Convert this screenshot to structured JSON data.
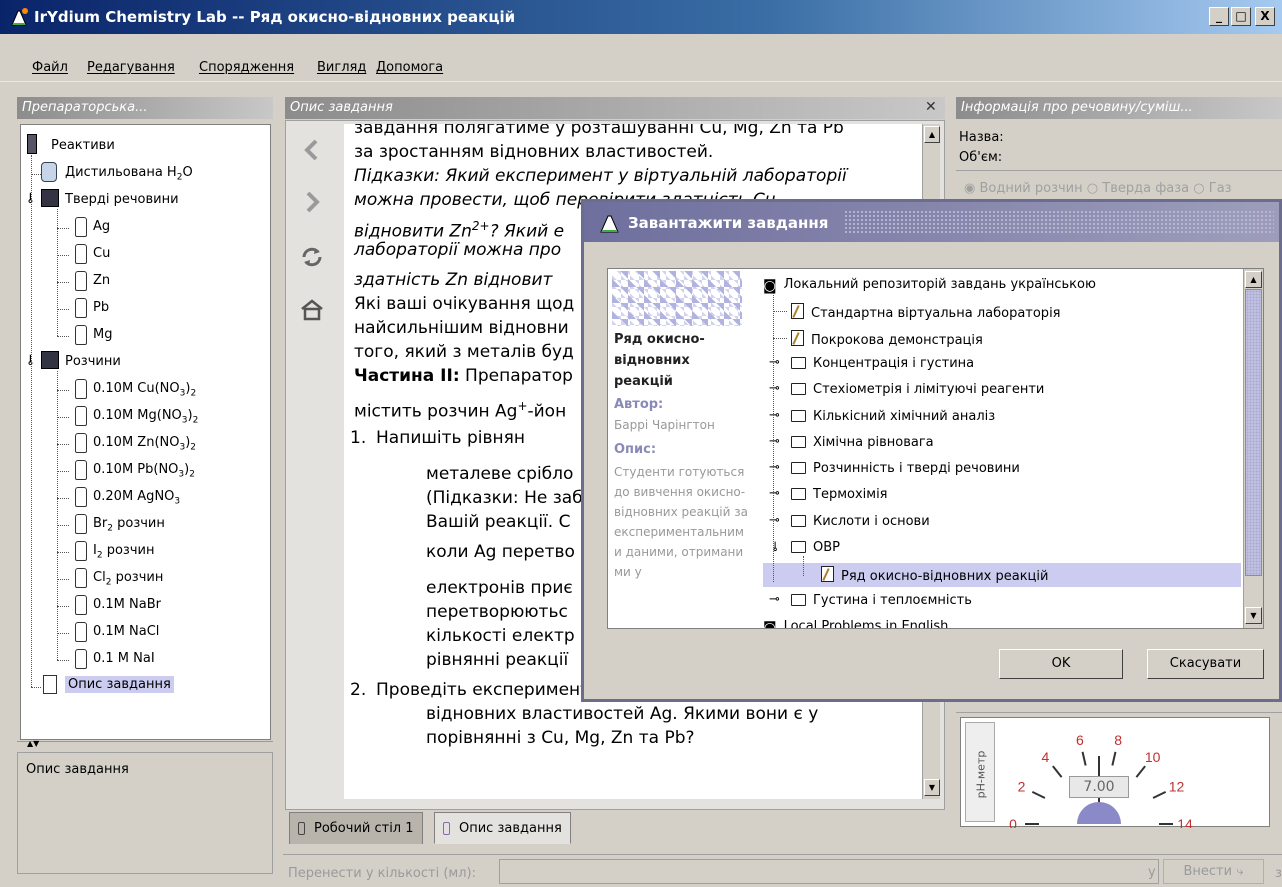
{
  "window": {
    "title": "IrYdium Chemistry Lab -- Ряд окисно-відновних реакцій",
    "controls": [
      "_",
      "□",
      "X"
    ]
  },
  "menu": [
    "Файл",
    "Редагування",
    "Спорядження",
    "Вигляд",
    "Допомога"
  ],
  "stockroom": {
    "header": "Препараторська...",
    "tree": [
      {
        "label": "Реактиви",
        "icon": "bottle-dark-icon"
      },
      {
        "label": "Дистильована H",
        "sub": "2",
        "suffix": "O",
        "icon": "water-jug-icon"
      },
      {
        "label": "Тверді речовини",
        "icon": "folder-icon"
      },
      {
        "label": "Ag",
        "icon": "bottle-icon"
      },
      {
        "label": "Cu",
        "icon": "bottle-icon"
      },
      {
        "label": "Zn",
        "icon": "bottle-icon"
      },
      {
        "label": "Pb",
        "icon": "bottle-icon"
      },
      {
        "label": "Mg",
        "icon": "bottle-icon"
      },
      {
        "label": "Розчини",
        "icon": "folder-icon"
      },
      {
        "label": "0.10M Cu(NO",
        "sub": "3",
        "suffix": ")",
        "sub2": "2",
        "icon": "bottle-icon"
      },
      {
        "label": "0.10M Mg(NO",
        "sub": "3",
        "suffix": ")",
        "sub2": "2",
        "icon": "bottle-icon"
      },
      {
        "label": "0.10M Zn(NO",
        "sub": "3",
        "suffix": ")",
        "sub2": "2",
        "icon": "bottle-icon"
      },
      {
        "label": "0.10M Pb(NO",
        "sub": "3",
        "suffix": ")",
        "sub2": "2",
        "icon": "bottle-icon"
      },
      {
        "label": "0.20M AgNO",
        "sub": "3",
        "icon": "bottle-icon"
      },
      {
        "label": "Br",
        "sub": "2",
        "suffix": " розчин",
        "icon": "bottle-icon"
      },
      {
        "label": "I",
        "sub": "2",
        "suffix": " розчин",
        "icon": "bottle-icon"
      },
      {
        "label": "Cl",
        "sub": "2",
        "suffix": " розчин",
        "icon": "bottle-icon"
      },
      {
        "label": "0.1M NaBr",
        "icon": "bottle-icon"
      },
      {
        "label": "0.1M NaCl",
        "icon": "bottle-icon"
      },
      {
        "label": "0.1 M NaI",
        "icon": "bottle-icon"
      },
      {
        "label": "Опис завдання",
        "icon": "document-icon",
        "selected": true
      }
    ],
    "bottom_label": "Опис завдання"
  },
  "task_panel": {
    "header": "Опис завдання",
    "lines": [
      {
        "text": "завдання полягатиме у розташуванні Cu, Mg, Zn та Pb",
        "style": "n"
      },
      {
        "text": "за зростанням відновних властивостей.",
        "style": "n"
      },
      {
        "text": "Підказки: Який експеримент у віртуальній лабораторії",
        "style": "i"
      },
      {
        "text": "можна провести, щоб перевірити здатність Cu",
        "style": "i"
      },
      {
        "pre": "відновити Zn",
        "sup": "2+",
        "post": "? Який е",
        "style": "i"
      },
      {
        "text": "лабораторії можна про",
        "style": "i"
      },
      {
        "text": "здатність Zn відновит",
        "style": "i"
      },
      {
        "text": "Які ваші очікування щод",
        "style": "n"
      },
      {
        "text": "найсильнішим відновни",
        "style": "n"
      },
      {
        "text": "того, який з металів буд",
        "style": "n"
      },
      {
        "bold": "Частина II:",
        "post": " Препаратор",
        "style": "n"
      },
      {
        "pre": "містить розчин Ag",
        "sup": "+",
        "post": "-йон",
        "style": "n"
      },
      {
        "num": "1.",
        "text": "Напишіть рівнян",
        "style": "n"
      },
      {
        "text": "металеве срібло",
        "style": "n"
      },
      {
        "text": "(Підказки: Не заб",
        "style": "n"
      },
      {
        "text": "Вашій реакції. С",
        "style": "n"
      },
      {
        "text": "коли Ag перетво",
        "style": "n"
      },
      {
        "text": "електронів приє",
        "style": "n"
      },
      {
        "text": "перетворюютьс",
        "style": "n"
      },
      {
        "text": "кількості електр",
        "style": "n"
      },
      {
        "text": "рівнянні реакції",
        "style": "n"
      },
      {
        "num": "2.",
        "text": "Проведіть експерименти для визначення",
        "style": "n"
      },
      {
        "text": "відновних властивостей Ag. Якими вони є у",
        "style": "n"
      },
      {
        "text": "порівнянні з Cu, Mg, Zn та Pb?",
        "style": "n"
      }
    ],
    "tabs": [
      "Робочий стіл 1",
      "Опис завдання"
    ]
  },
  "info_panel": {
    "header": "Інформація про речовину/суміш...",
    "name_label": "Назва:",
    "volume_label": "Об'єм:",
    "phases": [
      "Водний розчин",
      "Тверда фаза",
      "Газ"
    ],
    "phmeter": {
      "label": "pH-метр",
      "value": "7.00",
      "ticks": [
        "0",
        "2",
        "4",
        "6",
        "8",
        "10",
        "12",
        "14"
      ]
    }
  },
  "transfer_bar": {
    "label": "Перенести у кількості (мл):",
    "button": "Внести",
    "from": "з",
    "to": "у"
  },
  "dialog": {
    "title": "Завантажити завдання",
    "info": {
      "name": "Ряд окисно-відновних реакцій",
      "author_label": "Автор:",
      "author": "Баррі Чарінгтон",
      "desc_label": "Опис:",
      "desc": "Студенти готуються до вивчення окисно-відновних реакцій за експериментальними даними, отриманими у"
    },
    "tree": [
      {
        "label": "Локальний репозиторій завдань українською",
        "type": "repo",
        "depth": 0
      },
      {
        "label": "Стандартна віртуальна лабораторія",
        "type": "file",
        "depth": 1
      },
      {
        "label": "Покрокова демонстрація",
        "type": "file",
        "depth": 1
      },
      {
        "label": "Концентрація і густина",
        "type": "folder",
        "depth": 1
      },
      {
        "label": "Стехіометрія і лімітуючі реагенти",
        "type": "folder",
        "depth": 1
      },
      {
        "label": "Кількісний хімічний аналіз",
        "type": "folder",
        "depth": 1
      },
      {
        "label": "Хімічна рівновага",
        "type": "folder",
        "depth": 1
      },
      {
        "label": "Розчинність і тверді речовини",
        "type": "folder",
        "depth": 1
      },
      {
        "label": "Термохімія",
        "type": "folder",
        "depth": 1
      },
      {
        "label": "Кислоти і основи",
        "type": "folder",
        "depth": 1
      },
      {
        "label": "ОВР",
        "type": "folder-open",
        "depth": 1
      },
      {
        "label": "Ряд окисно-відновних реакцій",
        "type": "file",
        "depth": 2,
        "selected": true
      },
      {
        "label": "Густина і теплоємність",
        "type": "folder",
        "depth": 1
      },
      {
        "label": "Local Problems in English",
        "type": "repo",
        "depth": 0
      }
    ],
    "ok": "OK",
    "cancel": "Скасувати"
  },
  "colors": {
    "titlebar": "#0a246a",
    "selection": "#ccccf0",
    "dialog_title": "#7a7aa8",
    "needle": "#8a8ac8"
  }
}
